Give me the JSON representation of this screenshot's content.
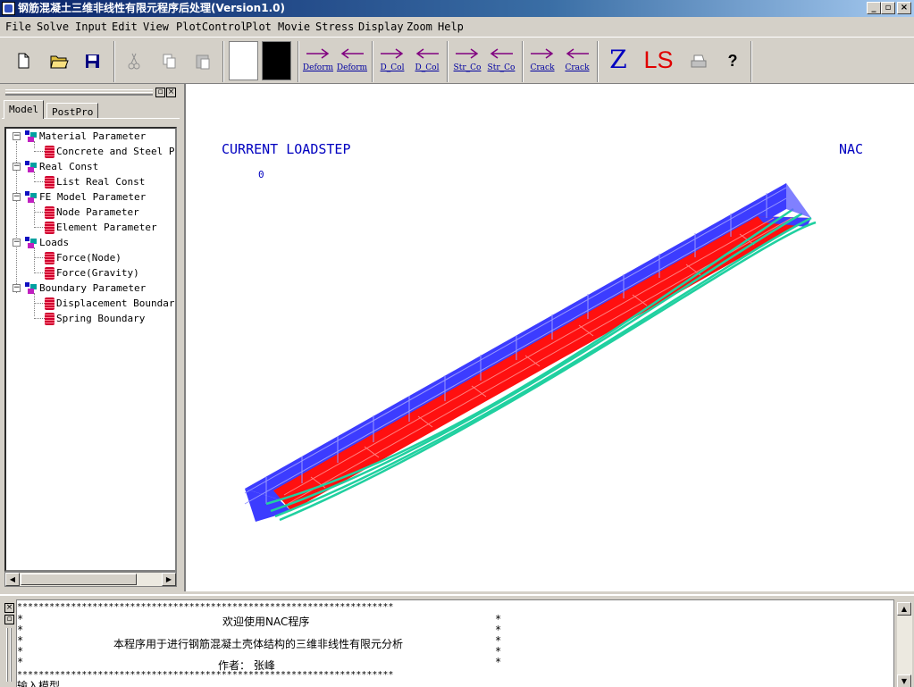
{
  "window": {
    "title": "钢筋混凝土三维非线性有限元程序后处理(Version1.0)",
    "controls": [
      "_",
      "▫",
      "×"
    ]
  },
  "menubar": [
    {
      "label": "File"
    },
    {
      "label": "Solve"
    },
    {
      "label": "Input"
    },
    {
      "label": "Edit"
    },
    {
      "label": "View"
    },
    {
      "label": "PlotControl"
    },
    {
      "label": "Plot"
    },
    {
      "label": "Movie"
    },
    {
      "label": "Stress"
    },
    {
      "label": "Display"
    },
    {
      "label": "Zoom"
    },
    {
      "label": "Help"
    }
  ],
  "toolbar": {
    "arrow_buttons": [
      {
        "label": "Deform",
        "dir": "right"
      },
      {
        "label": "Deform",
        "dir": "left"
      },
      {
        "label": "D_Col",
        "dir": "right"
      },
      {
        "label": "D_Col",
        "dir": "left"
      },
      {
        "label": "Str_Co",
        "dir": "right"
      },
      {
        "label": "Str_Co",
        "dir": "left"
      },
      {
        "label": "Crack",
        "dir": "right"
      },
      {
        "label": "Crack",
        "dir": "left"
      }
    ],
    "z_label": "Z",
    "ls_label": "LS",
    "help_label": "?",
    "colors": {
      "arrow": "#800080",
      "z": "#0000c0",
      "ls": "#e00000"
    }
  },
  "left_panel": {
    "tabs": [
      "Model",
      "PostPro"
    ],
    "active_tab": "Model",
    "tree": [
      {
        "label": "Material Parameter",
        "children": [
          "Concrete and Steel Pr"
        ]
      },
      {
        "label": "Real Const",
        "children": [
          "List Real Const"
        ]
      },
      {
        "label": "FE Model Parameter",
        "children": [
          "Node Parameter",
          "Element Parameter"
        ]
      },
      {
        "label": "Loads",
        "children": [
          "Force(Node)",
          "Force(Gravity)"
        ]
      },
      {
        "label": "Boundary Parameter",
        "children": [
          "Displacement Boundary",
          "Spring Boundary"
        ]
      }
    ]
  },
  "viewport": {
    "label_left": "CURRENT LOADSTEP",
    "label_right": "NAC",
    "step_value": "0",
    "colors": {
      "mesh_blue": "#3838ff",
      "mesh_red": "#ff0000",
      "tendon": "#20d0a0",
      "text": "#0000c0"
    }
  },
  "console": {
    "stars": "**********************************************************************",
    "lines": [
      "欢迎使用NAC程序",
      "本程序用于进行钢筋混凝土壳体结构的三维非线性有限元分析",
      "作者： 张峰"
    ],
    "input_line": "输入模型"
  }
}
